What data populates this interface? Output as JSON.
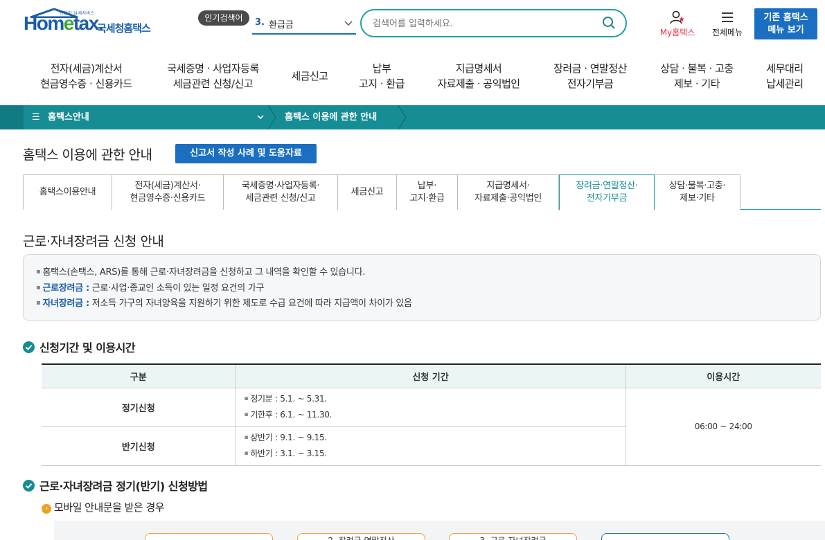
{
  "header": {
    "logo_small": "안전한 납세서비스",
    "logo_main_a": "Hom",
    "logo_main_e": "e",
    "logo_main_b": "tax.",
    "logo_kor": "국세청홈택스",
    "popular_tag": "인기검색어",
    "popular_num": "3.",
    "popular_text": "환급금",
    "search_placeholder": "검색어를 입력하세요.",
    "my_hometax": "My홈택스",
    "all_menu": "전체메뉴",
    "old_menu_line1": "기존 홈택스",
    "old_menu_line2": "메뉴 보기"
  },
  "gnb": [
    {
      "l1": "전자(세금)계산서",
      "l2": "현금영수증 · 신용카드"
    },
    {
      "l1": "국세증명 · 사업자등록",
      "l2": "세금관련 신청/신고"
    },
    {
      "l1": "세금신고",
      "l2": ""
    },
    {
      "l1": "납부",
      "l2": "고지 · 환급"
    },
    {
      "l1": "지급명세서",
      "l2": "자료제출 · 공익법인"
    },
    {
      "l1": "장려금 · 연말정산",
      "l2": "전자기부금"
    },
    {
      "l1": "상담 · 불복 · 고충",
      "l2": "제보 · 기타"
    },
    {
      "l1": "세무대리",
      "l2": "납세관리"
    }
  ],
  "breadcrumb": {
    "first": "홈택스안내",
    "second": "홈택스 이용에 관한 안내"
  },
  "page": {
    "title": "홈택스 이용에 관한 안내",
    "help_button": "신고서 작성 사례 및 도움자료"
  },
  "tabs": [
    {
      "l1": "홈택스이용안내",
      "l2": ""
    },
    {
      "l1": "전자(세금)계산서·",
      "l2": "현금영수증·신용카드"
    },
    {
      "l1": "국세증명·사업자등록·",
      "l2": "세금관련 신청/신고"
    },
    {
      "l1": "세금신고",
      "l2": ""
    },
    {
      "l1": "납부·",
      "l2": "고지·환급"
    },
    {
      "l1": "지급명세서·",
      "l2": "자료제출·공익법인"
    },
    {
      "l1": "장려금·연말정산·",
      "l2": "전자기부금"
    },
    {
      "l1": "상담·불복·고충·",
      "l2": "제보·기타"
    }
  ],
  "section": {
    "title": "근로·자녀장려금 신청 안내",
    "info": {
      "line1": "홈택스(손택스, ARS)를 통해 근로·자녀장려금을 신청하고 그 내역을 확인할 수 있습니다.",
      "line2_label": "근로장려금 :",
      "line2_text": " 근로·사업·종교인 소득이 있는 일정 요건의 가구",
      "line3_label": "자녀장려금 :",
      "line3_text": " 저소득 가구의 자녀양육을 지원하기 위한 제도로 수급 요건에 따라 지급액이 차이가 있음"
    }
  },
  "period_section": {
    "title": "신청기간 및 이용시간",
    "headers": [
      "구분",
      "신청 기간",
      "이용시간"
    ],
    "rows": [
      {
        "label": "정기신청",
        "p1": "정기분 : 5.1. ~ 5.31.",
        "p2": "기한후 : 6.1. ~ 11.30."
      },
      {
        "label": "반기신청",
        "p1": "상반기 : 9.1. ~ 9.15.",
        "p2": "하반기 : 3.1. ~ 3.15."
      }
    ],
    "time": "06:00 ~ 24:00"
  },
  "method_section": {
    "title": "근로·자녀장려금 정기(반기) 신청방법",
    "sub": "모바일 안내문을 받은 경우",
    "cards": [
      "",
      "2. 장려금·연말정산",
      "3. 근로·자녀장려금",
      ""
    ]
  },
  "colors": {
    "brand_blue": "#1a6fc2",
    "teal": "#168c95",
    "alert_red": "#e8334a"
  }
}
